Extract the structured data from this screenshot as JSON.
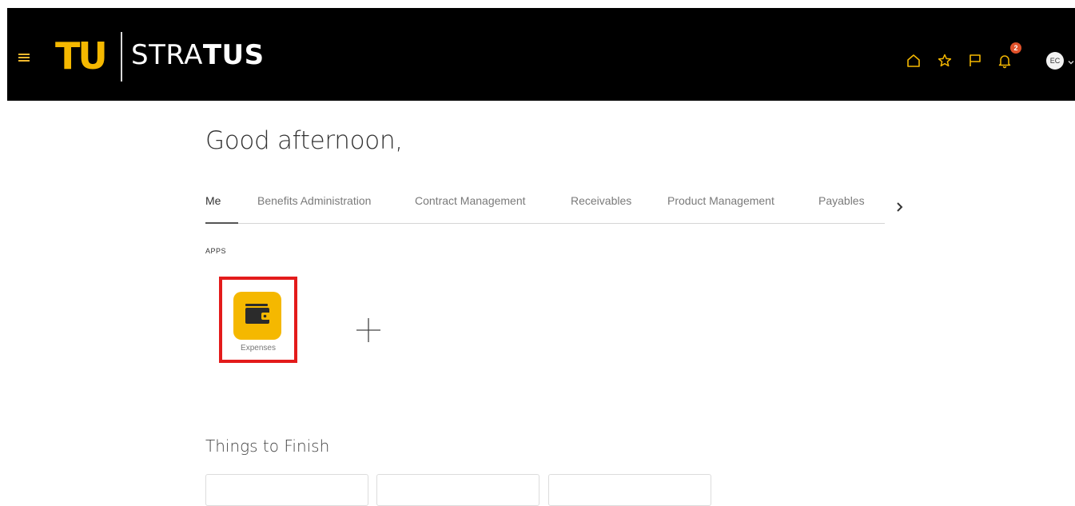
{
  "header": {
    "logo_mark": "TU",
    "logo_name_plain": "STRA",
    "logo_name_bold": "TUS",
    "notification_count": "2",
    "user_initials": "EC",
    "icons": [
      "home-icon",
      "star-icon",
      "flag-icon",
      "bell-icon"
    ],
    "accent_color": "#f5b800"
  },
  "greeting": "Good afternoon,",
  "tabs": [
    {
      "label": "Me",
      "active": true
    },
    {
      "label": "Benefits Administration"
    },
    {
      "label": "Contract Management"
    },
    {
      "label": "Receivables"
    },
    {
      "label": "Product Management"
    },
    {
      "label": "Payables"
    }
  ],
  "apps": {
    "section_label": "APPS",
    "items": [
      {
        "label": "Expenses",
        "icon": "wallet-icon"
      }
    ],
    "add_icon": "plus-icon"
  },
  "things_to_finish": {
    "title": "Things to Finish",
    "cards": [
      "",
      "",
      ""
    ]
  }
}
